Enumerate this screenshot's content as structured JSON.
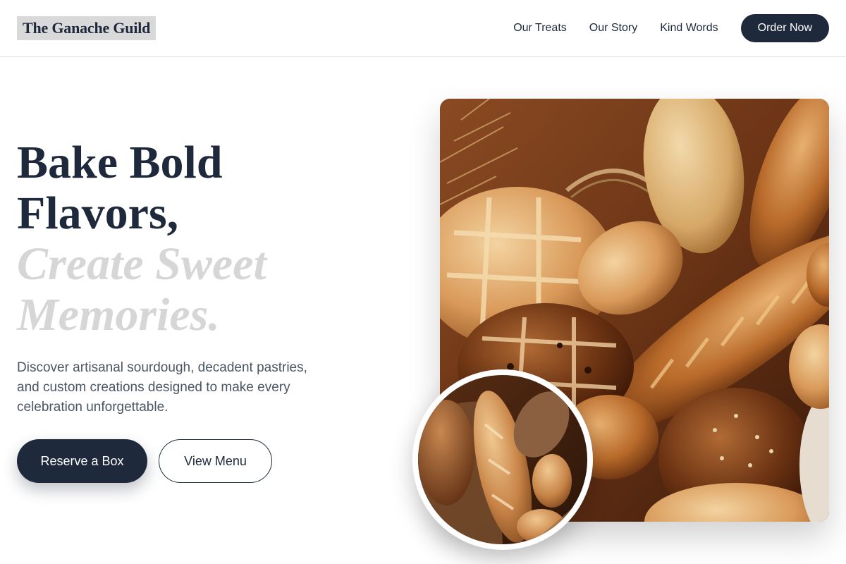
{
  "brand": {
    "name": "The Ganache Guild"
  },
  "nav": {
    "links": [
      "Our Treats",
      "Our Story",
      "Kind Words"
    ],
    "cta": "Order Now"
  },
  "hero": {
    "title_line1": "Bake Bold",
    "title_line2": "Flavors,",
    "title_line3": "Create Sweet",
    "title_line4": "Memories.",
    "description": "Discover artisanal sourdough, decadent pastries, and custom creations designed to make every celebration unforgettable.",
    "primary_button": "Reserve a Box",
    "secondary_button": "View Menu"
  },
  "images": {
    "main": "bread-assortment-photo",
    "circle": "baguettes-basket-photo"
  },
  "colors": {
    "primary": "#1e293b",
    "accent_text": "#d6d6d6",
    "body_text": "#4b5563"
  }
}
